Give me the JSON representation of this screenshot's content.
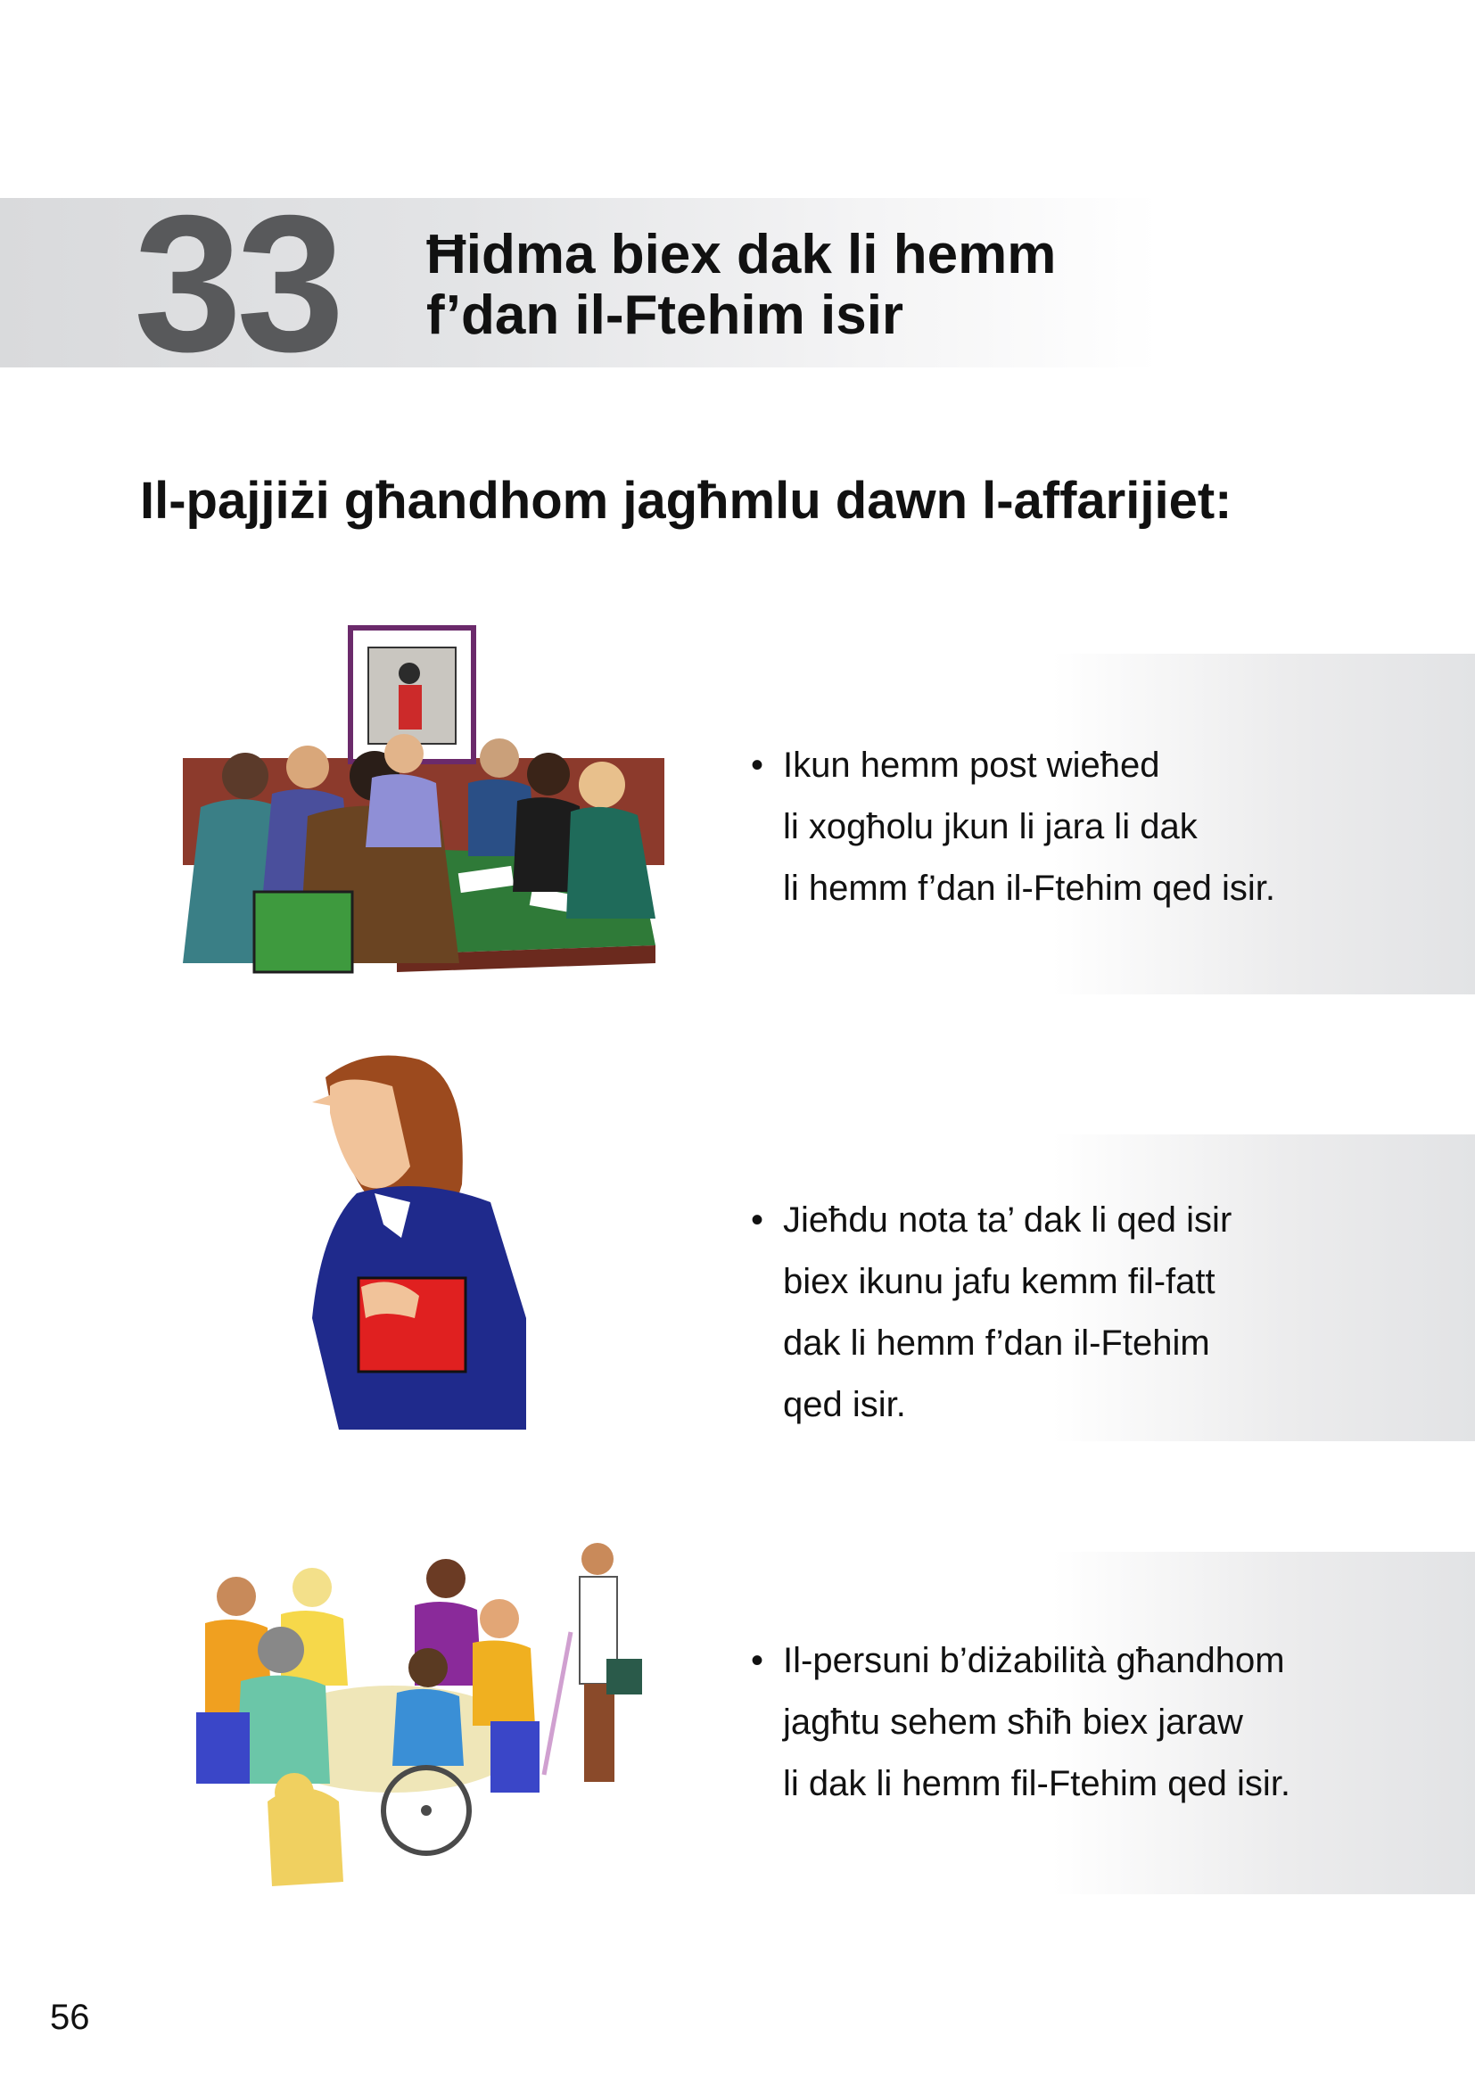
{
  "header": {
    "chapter_number": "33",
    "title_line1": "Ħidma biex dak li hemm",
    "title_line2": "f’dan il-Ftehim isir"
  },
  "section": {
    "heading": "Il-pajjiżi għandhom jagħmlu dawn l-affarijiet:"
  },
  "items": [
    {
      "illustration": "meeting-around-table-illustration",
      "lines": [
        "Ikun hemm post wieħed",
        "li xogħolu jkun li jara li dak",
        "li hemm f’dan il-Ftehim qed isir."
      ]
    },
    {
      "illustration": "woman-holding-folder-illustration",
      "lines": [
        "Jieħdu nota ta’ dak li qed isir",
        "biex ikunu jafu kemm fil-fatt",
        "dak li hemm f’dan il-Ftehim",
        "qed isir."
      ]
    },
    {
      "illustration": "group-with-disabilities-illustration",
      "lines": [
        "Il-persuni b’diżabilità għandhom",
        "jagħtu sehem sħiħ biex jaraw",
        "li dak li hemm fil-Ftehim qed isir."
      ]
    }
  ],
  "bullet_symbol": "•",
  "footer": {
    "page_number": "56"
  }
}
